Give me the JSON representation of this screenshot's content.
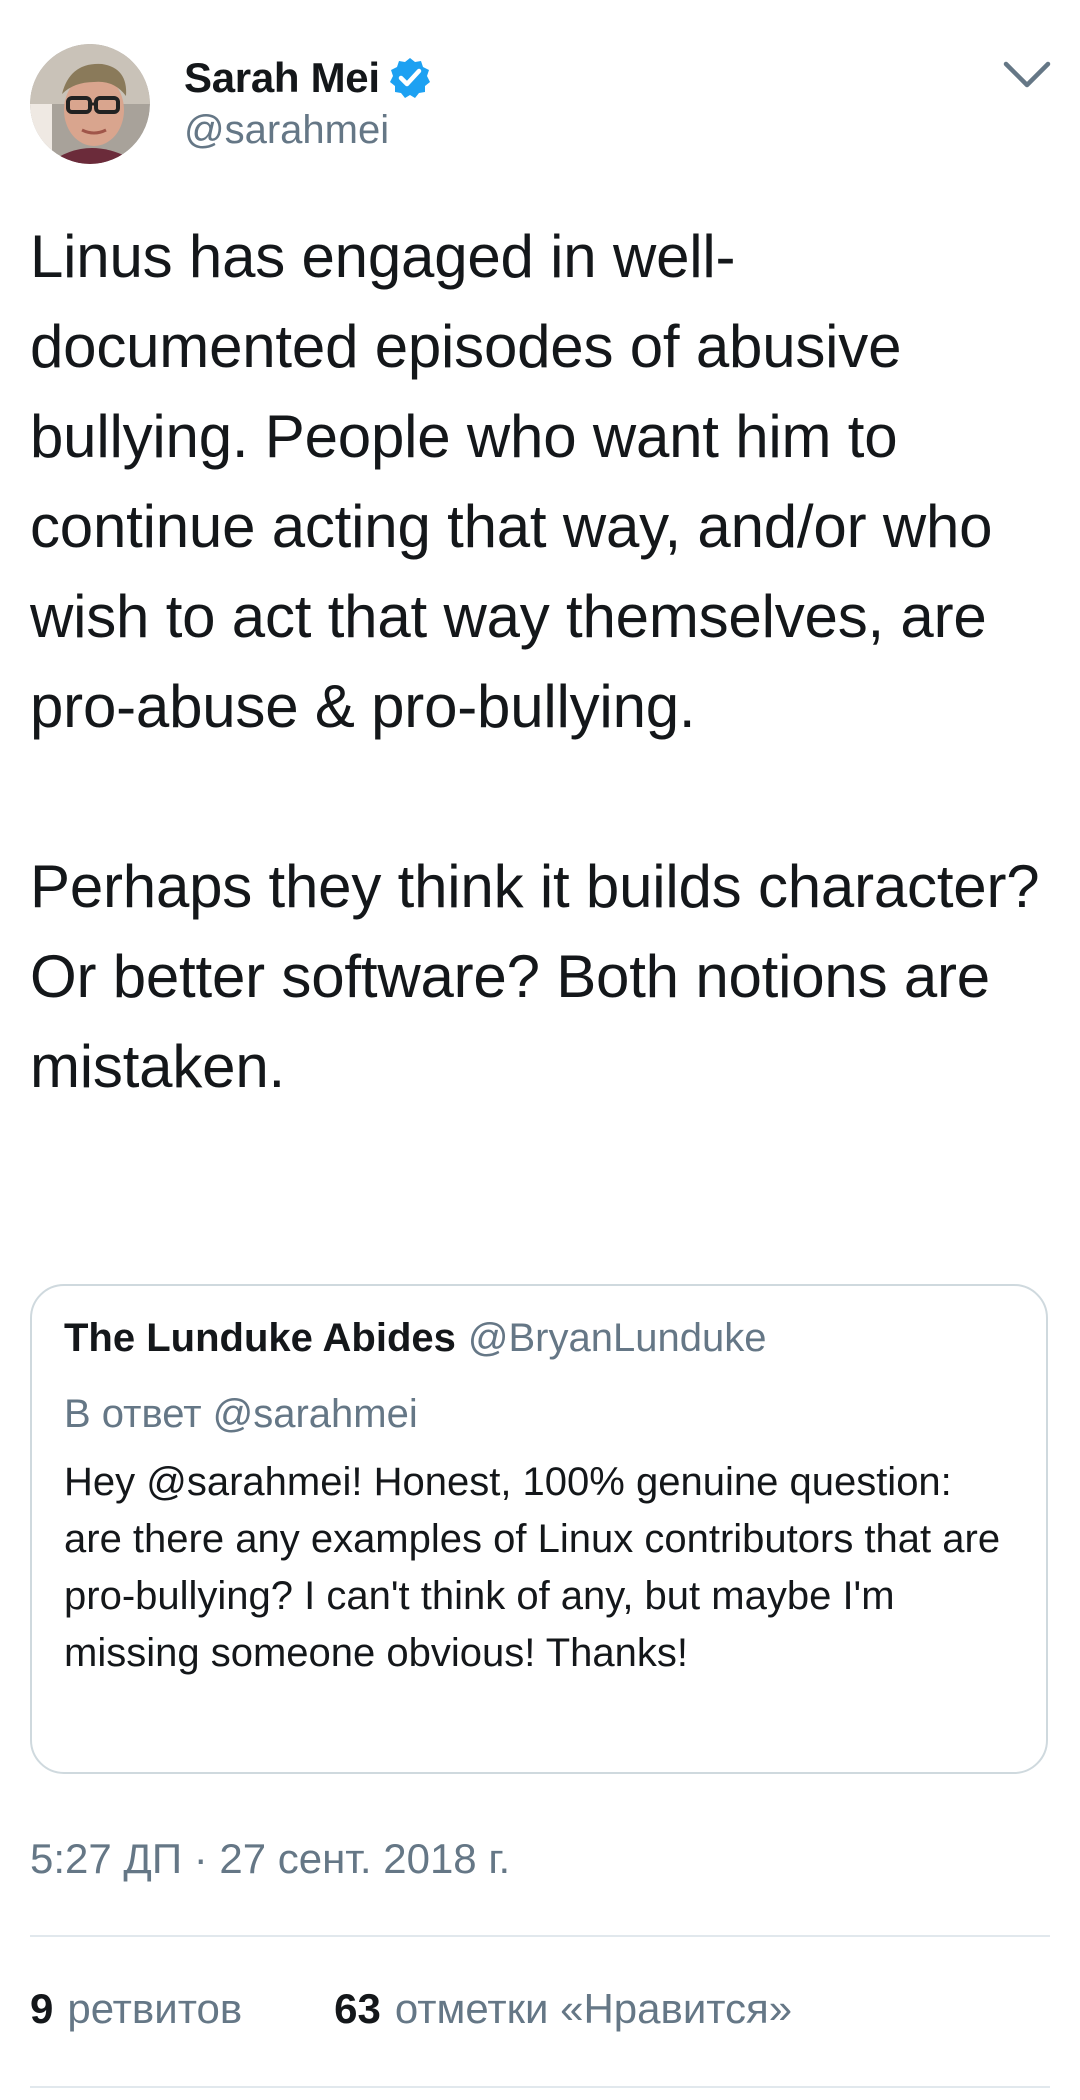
{
  "author": {
    "name": "Sarah Mei",
    "handle": "@sarahmei",
    "verified_icon": "verified-badge-icon",
    "avatar": "profile-photo"
  },
  "menu_icon": "chevron-down-icon",
  "tweet": {
    "paragraphs": [
      "Linus has engaged in well-documented episodes of abusive bullying. People who want him to continue acting that way, and/or who wish to act that way themselves, are pro-abuse & pro-bullying.",
      "Perhaps they think it builds character? Or better software? Both notions are mistaken."
    ]
  },
  "quoted_tweet": {
    "author_name": "The Lunduke Abides",
    "author_handle": "@BryanLunduke",
    "reply_to": "В ответ @sarahmei",
    "text": "Hey @sarahmei!  Honest, 100% genuine question: are there any examples of Linux contributors that are pro-bullying?  I can't think of any, but maybe I'm missing someone obvious!  Thanks!"
  },
  "timestamp": "5:27 ДП · 27 сент. 2018 г.",
  "stats": {
    "retweets_count": "9",
    "retweets_label": "ретвитов",
    "likes_count": "63",
    "likes_label": "отметки «Нравится»"
  },
  "colors": {
    "text_primary": "#14171a",
    "text_secondary": "#657786",
    "verified_blue": "#1da1f2",
    "border": "#cfd9de",
    "divider": "#e1e8ed"
  }
}
